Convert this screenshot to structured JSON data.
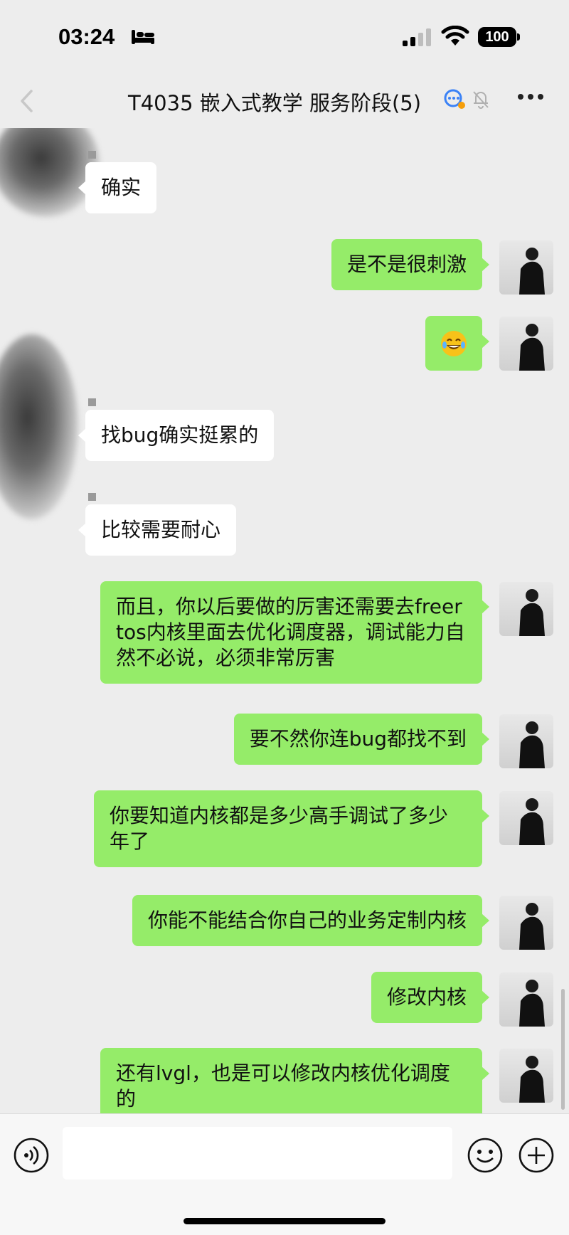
{
  "status_bar": {
    "time": "03:24",
    "battery": "100"
  },
  "header": {
    "title": "T4035 嵌入式教学 服务阶段(5)"
  },
  "messages": [
    {
      "side": "left",
      "text": "确实"
    },
    {
      "side": "right",
      "text": "是不是很刺激"
    },
    {
      "side": "right",
      "emoji": "tears-of-joy"
    },
    {
      "side": "left",
      "text": "找bug确实挺累的"
    },
    {
      "side": "left",
      "text": "比较需要耐心"
    },
    {
      "side": "right",
      "text": "而且，你以后要做的厉害还需要去freertos内核里面去优化调度器，调试能力自然不必说，必须非常厉害"
    },
    {
      "side": "right",
      "text": "要不然你连bug都找不到"
    },
    {
      "side": "right",
      "text": "你要知道内核都是多少高手调试了多少年了"
    },
    {
      "side": "right",
      "text": "你能不能结合你自己的业务定制内核"
    },
    {
      "side": "right",
      "text": "修改内核"
    },
    {
      "side": "right",
      "text": "还有lvgl，也是可以修改内核优化调度的"
    }
  ],
  "colors": {
    "background": "#ededed",
    "outgoing_bubble": "#95ec69",
    "incoming_bubble": "#ffffff"
  }
}
